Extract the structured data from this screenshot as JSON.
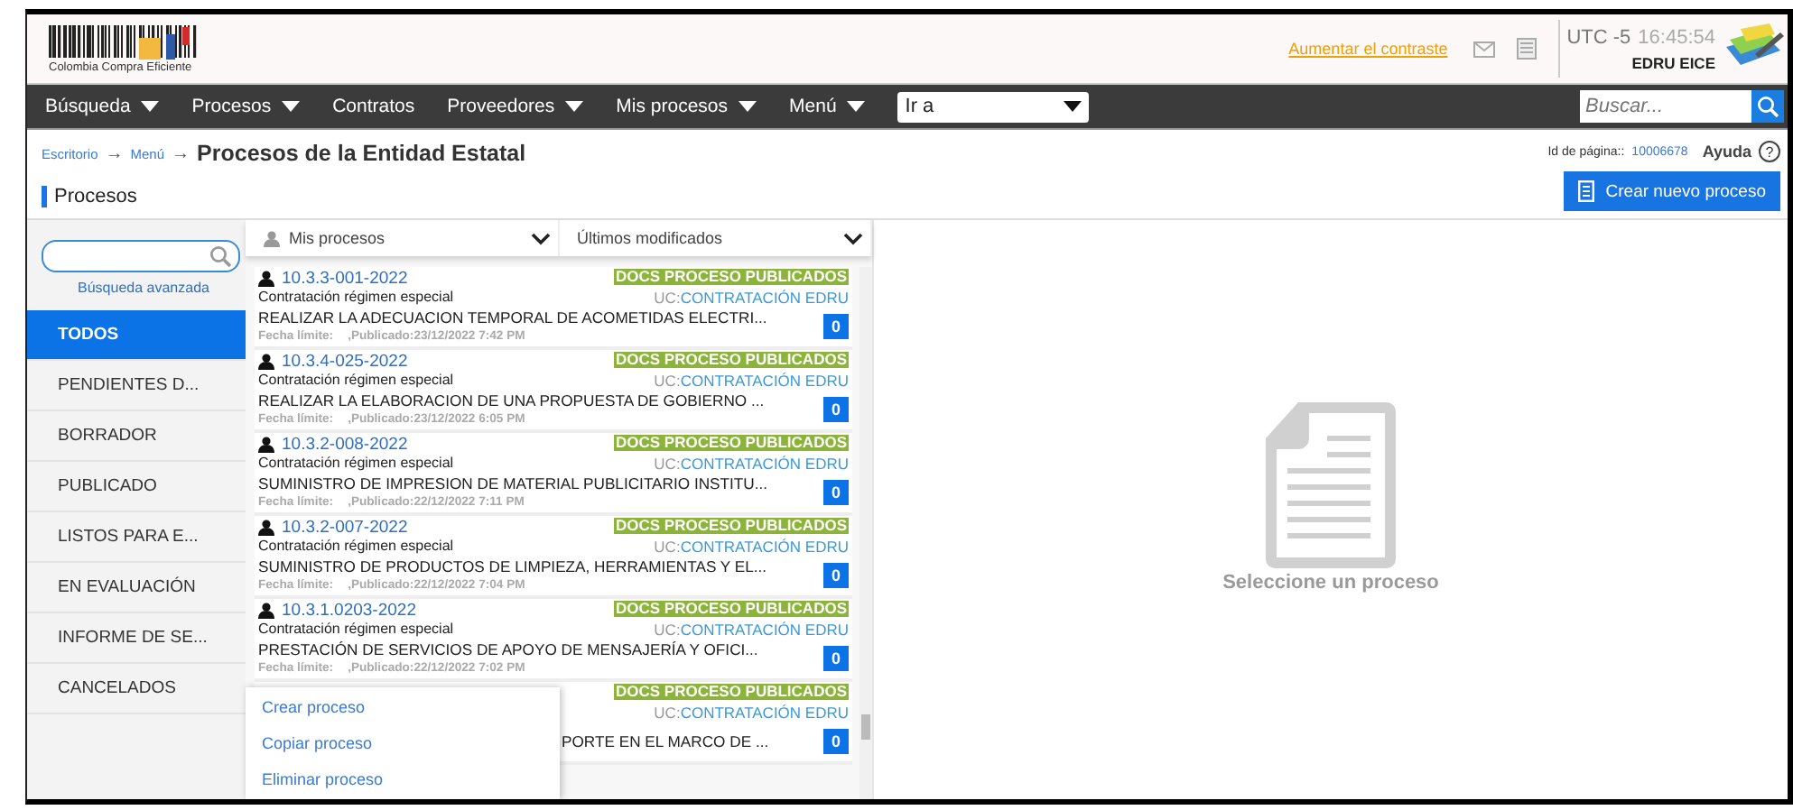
{
  "header": {
    "logo_text": "Colombia Compra Eficiente",
    "contrast_link": "Aumentar el contraste",
    "timezone": "UTC -5",
    "time": "16:45:54",
    "user": "EDRU EICE"
  },
  "nav": {
    "items": [
      {
        "label": "Búsqueda",
        "has_menu": true
      },
      {
        "label": "Procesos",
        "has_menu": true
      },
      {
        "label": "Contratos",
        "has_menu": false
      },
      {
        "label": "Proveedores",
        "has_menu": true
      },
      {
        "label": "Mis procesos",
        "has_menu": true
      },
      {
        "label": "Menú",
        "has_menu": true
      }
    ],
    "goto": {
      "value": "Ir a"
    },
    "search": {
      "placeholder": "Buscar..."
    }
  },
  "page": {
    "breadcrumb": [
      {
        "label": "Escritorio",
        "separator": "→"
      },
      {
        "label": "Menú",
        "separator": "→"
      }
    ],
    "title": "Procesos de la Entidad Estatal",
    "subtitle": "Procesos",
    "page_id_label": "Id de página::",
    "page_id": "10006678",
    "help": "Ayuda",
    "help_glyph": "?",
    "create_button": "Crear nuevo proceso"
  },
  "sidebar": {
    "advanced_search": "Búsqueda avanzada",
    "items": [
      {
        "label": "TODOS",
        "selected": true
      },
      {
        "label": "PENDIENTES D...",
        "selected": false
      },
      {
        "label": "BORRADOR",
        "selected": false
      },
      {
        "label": "PUBLICADO",
        "selected": false
      },
      {
        "label": "LISTOS PARA E...",
        "selected": false
      },
      {
        "label": "EN EVALUACIÓN",
        "selected": false
      },
      {
        "label": "INFORME DE SE...",
        "selected": false
      },
      {
        "label": "CANCELADOS",
        "selected": false
      }
    ]
  },
  "list": {
    "filter": "Mis procesos",
    "sort": "Últimos modificados",
    "items": [
      {
        "kind": "full",
        "code": "10.3.3-001-2022",
        "status": "DOCS PROCESO PUBLICADOS",
        "type": "Contratación régimen especial",
        "uc_label": "UC:",
        "unit": "CONTRATACIÓN EDRU",
        "title": "REALIZAR LA ADECUACION TEMPORAL DE ACOMETIDAS ELECTRI...",
        "deadline_label": "Fecha límite:",
        "published": ",Publicado:23/12/2022 7:42 PM",
        "count": "0"
      },
      {
        "kind": "full",
        "code": "10.3.4-025-2022",
        "status": "DOCS PROCESO PUBLICADOS",
        "type": "Contratación régimen especial",
        "uc_label": "UC:",
        "unit": "CONTRATACIÓN EDRU",
        "title": "REALIZAR LA ELABORACION DE UNA PROPUESTA DE GOBIERNO ...",
        "deadline_label": "Fecha límite:",
        "published": ",Publicado:23/12/2022 6:05 PM",
        "count": "0"
      },
      {
        "kind": "full",
        "code": "10.3.2-008-2022",
        "status": "DOCS PROCESO PUBLICADOS",
        "type": "Contratación régimen especial",
        "uc_label": "UC:",
        "unit": "CONTRATACIÓN EDRU",
        "title": "SUMINISTRO DE IMPRESION DE MATERIAL PUBLICITARIO INSTITU...",
        "deadline_label": "Fecha límite:",
        "published": ",Publicado:22/12/2022 7:11 PM",
        "count": "0"
      },
      {
        "kind": "full",
        "code": "10.3.2-007-2022",
        "status": "DOCS PROCESO PUBLICADOS",
        "type": "Contratación régimen especial",
        "uc_label": "UC:",
        "unit": "CONTRATACIÓN EDRU",
        "title": "SUMINISTRO DE PRODUCTOS DE LIMPIEZA, HERRAMIENTAS Y EL...",
        "deadline_label": "Fecha límite:",
        "published": ",Publicado:22/12/2022 7:04 PM",
        "count": "0"
      },
      {
        "kind": "full",
        "code": "10.3.1.0203-2022",
        "status": "DOCS PROCESO PUBLICADOS",
        "type": "Contratación régimen especial",
        "uc_label": "UC:",
        "unit": "CONTRATACIÓN EDRU",
        "title": "PRESTACIÓN DE SERVICIOS DE APOYO DE MENSAJERÍA Y OFICI...",
        "deadline_label": "Fecha límite:",
        "published": ",Publicado:22/12/2022 7:02 PM",
        "count": "0"
      },
      {
        "kind": "partial",
        "status": "DOCS PROCESO PUBLICADOS",
        "uc_label": "UC:",
        "unit": "CONTRATACIÓN EDRU",
        "title": "PORTE EN EL MARCO DE ...",
        "count": "0"
      }
    ]
  },
  "context_menu": {
    "items": [
      "Crear proceso",
      "Copiar proceso",
      "Eliminar proceso"
    ]
  },
  "detail": {
    "empty_message": "Seleccione un proceso"
  }
}
